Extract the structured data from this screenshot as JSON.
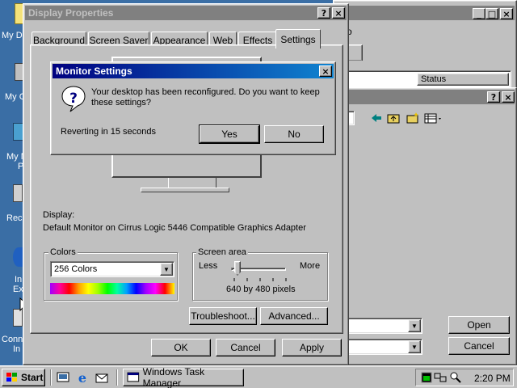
{
  "desktop": {
    "icons": [
      {
        "label": "My D",
        "name": "my-documents"
      },
      {
        "label": "My C",
        "name": "my-computer"
      },
      {
        "label": "My N",
        "name": "my-network-places"
      },
      {
        "label": "P",
        "name": "network-places-continued"
      },
      {
        "label": "Rec",
        "name": "recycle-bin"
      },
      {
        "label": "In",
        "name": "internet-explorer-1"
      },
      {
        "label": "Ex",
        "name": "internet-explorer-2"
      },
      {
        "label": "Conn",
        "name": "connect-1"
      },
      {
        "label": "In",
        "name": "connect-2"
      }
    ]
  },
  "bg_window": {
    "tab_fragment": "ce",
    "tab_fragment2": "o",
    "column_status": "Status",
    "open_label": "Open",
    "cancel_label": "Cancel"
  },
  "display_properties": {
    "title": "Display Properties",
    "tabs": [
      "Background",
      "Screen Saver",
      "Appearance",
      "Web",
      "Effects",
      "Settings"
    ],
    "selected_tab": "Settings",
    "display_label": "Display:",
    "display_value": "Default Monitor on Cirrus Logic 5446 Compatible Graphics Adapter",
    "colors_group": "Colors",
    "colors_value": "256 Colors",
    "screen_area_group": "Screen area",
    "less_label": "Less",
    "more_label": "More",
    "resolution": "640 by 480 pixels",
    "troubleshoot_label": "Troubleshoot...",
    "advanced_label": "Advanced...",
    "ok_label": "OK",
    "cancel_label": "Cancel",
    "apply_label": "Apply"
  },
  "monitor_settings": {
    "title": "Monitor Settings",
    "message": "Your desktop has been reconfigured.  Do you want to keep these settings?",
    "countdown": "Reverting in 15 seconds",
    "yes_label": "Yes",
    "no_label": "No"
  },
  "taskbar": {
    "start_label": "Start",
    "task_label": "Windows Task Manager",
    "clock": "2:20 PM"
  },
  "colors": {
    "desktop": "#3a6ea5",
    "titlebar_active": "#000080",
    "face": "#c0c0c0"
  }
}
